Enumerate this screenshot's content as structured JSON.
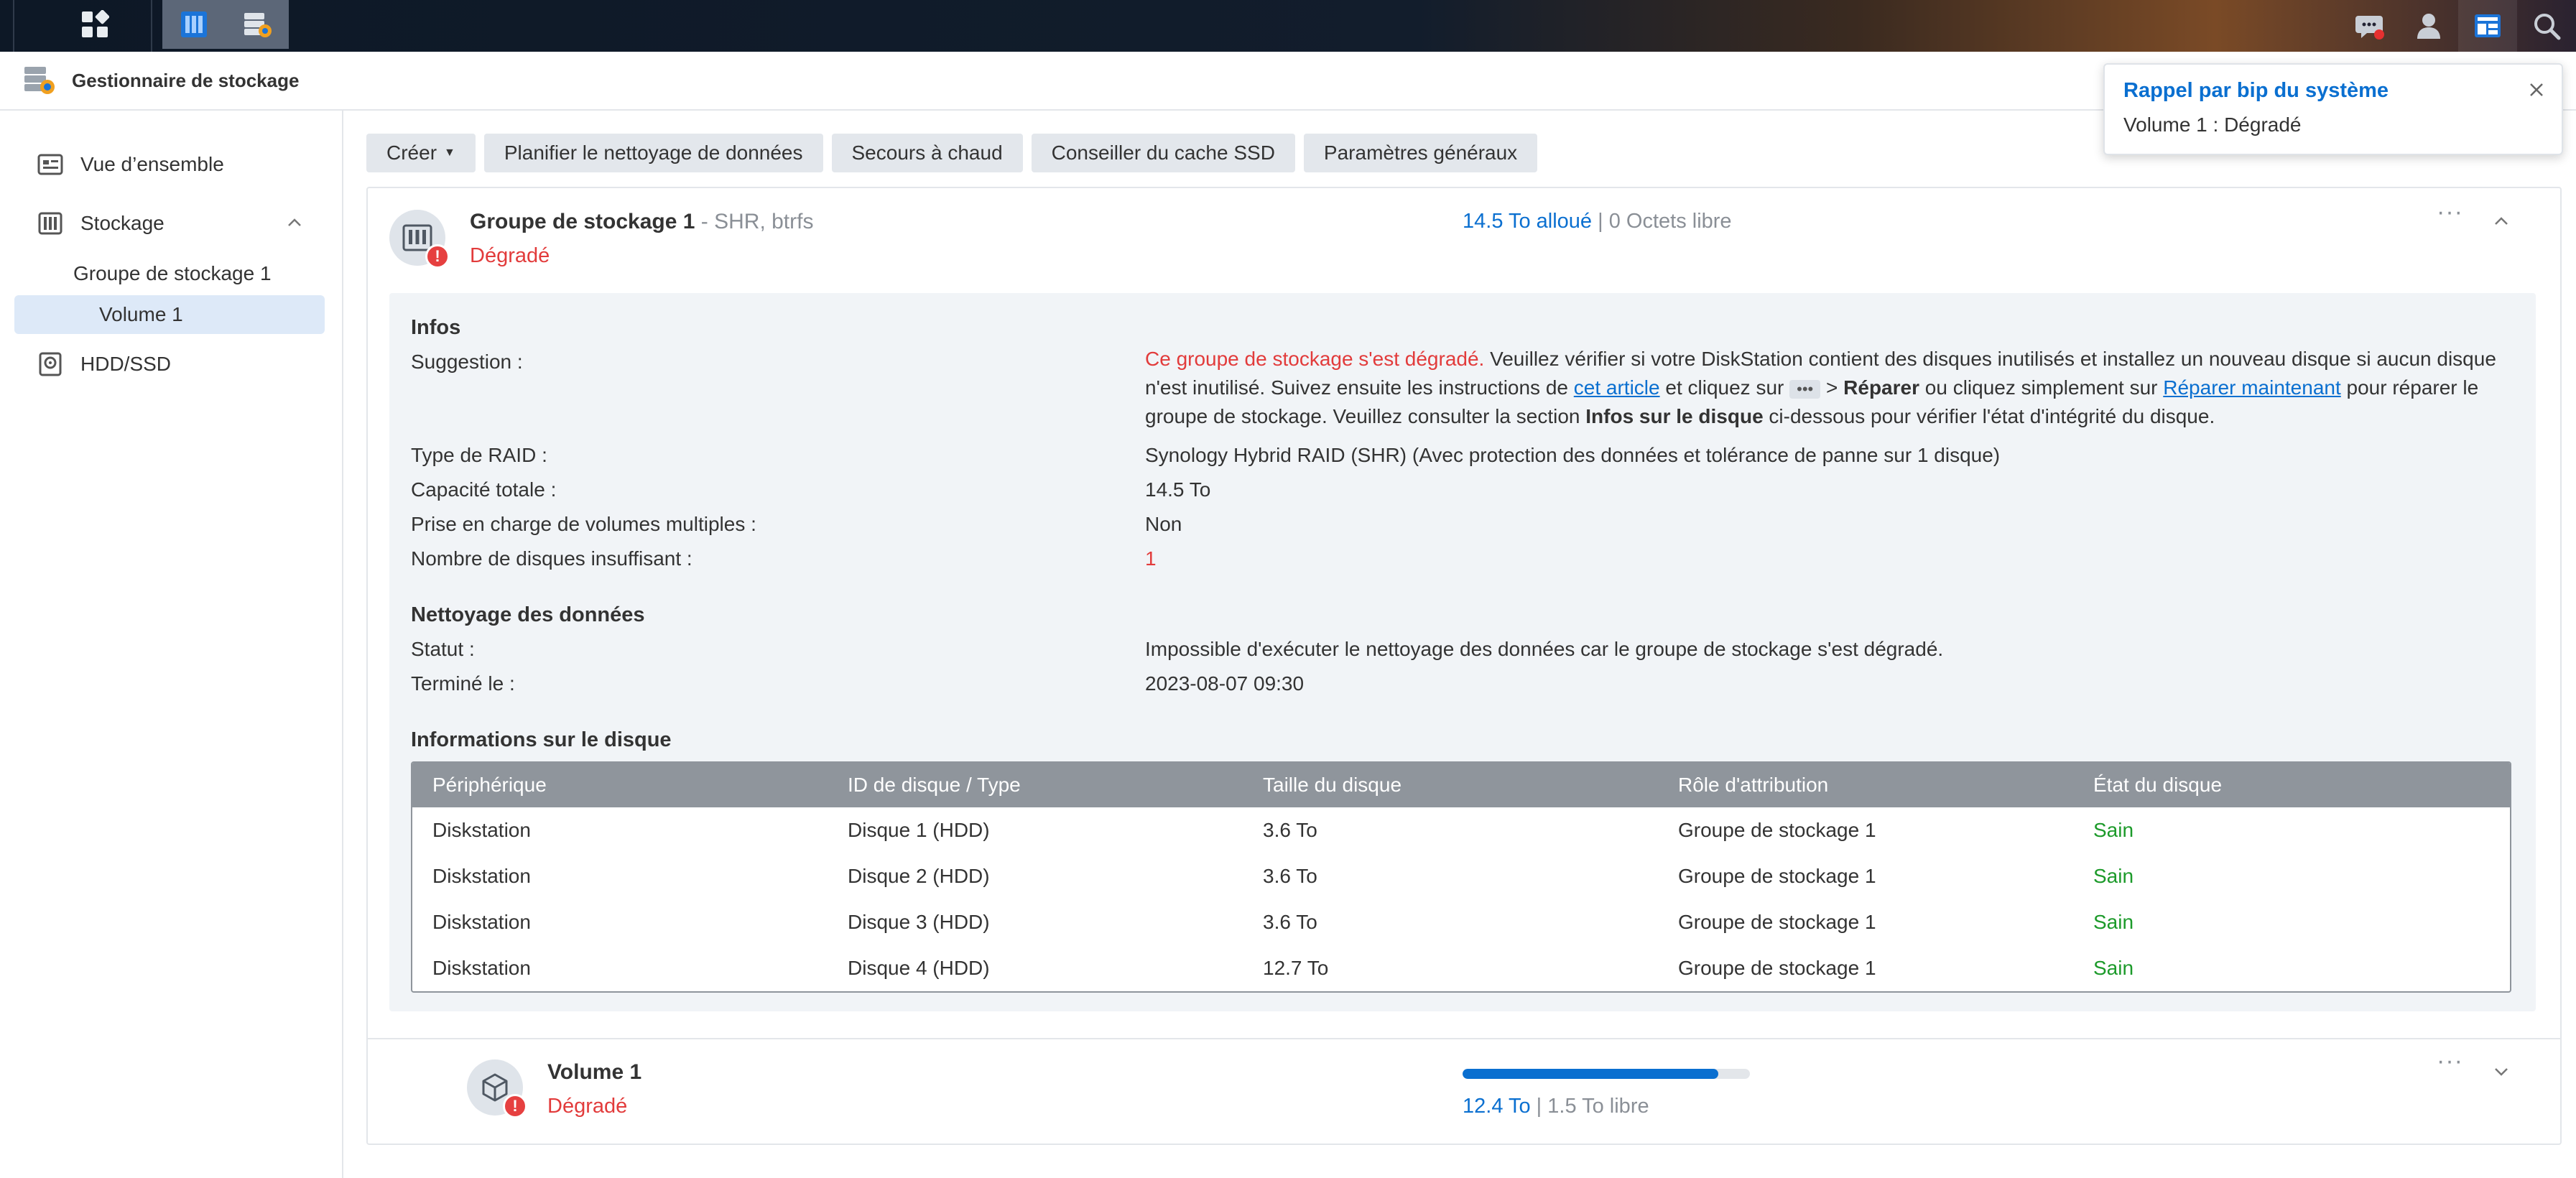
{
  "app": {
    "title": "Gestionnaire de stockage"
  },
  "sidebar": {
    "overview": "Vue d’ensemble",
    "storage": "Stockage",
    "pool": "Groupe de stockage 1",
    "volume": "Volume 1",
    "hdd": "HDD/SSD"
  },
  "toolbar": {
    "create": "Créer",
    "schedule": "Planifier le nettoyage de données",
    "hotspare": "Secours à chaud",
    "ssd": "Conseiller du cache SSD",
    "settings": "Paramètres généraux"
  },
  "pool": {
    "name": "Groupe de stockage 1",
    "meta": " - SHR, btrfs",
    "status": "Dégradé",
    "allocated": "14.5 To alloué",
    "separator": " | ",
    "free": "0 Octets libre"
  },
  "infos": {
    "title": "Infos",
    "suggestion_label": "Suggestion :",
    "suggestion_red": "Ce groupe de stockage s'est dégradé.",
    "suggestion_p1": " Veuillez vérifier si votre DiskStation contient des disques inutilisés et installez un nouveau disque si aucun disque n'est inutilisé. Suivez ensuite les instructions de ",
    "suggestion_link1": "cet article",
    "suggestion_p2": " et cliquez sur ",
    "suggestion_chip": "•••",
    "suggestion_p3": " > ",
    "suggestion_bold1": "Réparer",
    "suggestion_p4": " ou cliquez simplement sur ",
    "suggestion_link2": "Réparer maintenant",
    "suggestion_p5": " pour réparer le groupe de stockage. Veuillez consulter la section ",
    "suggestion_bold2": "Infos sur le disque",
    "suggestion_p6": " ci-dessous pour vérifier l'état d'intégrité du disque.",
    "raid_label": "Type de RAID :",
    "raid_value": "Synology Hybrid RAID (SHR) (Avec protection des données et tolérance de panne sur 1 disque)",
    "capacity_label": "Capacité totale :",
    "capacity_value": "14.5 To",
    "multi_label": "Prise en charge de volumes multiples :",
    "multi_value": "Non",
    "missing_label": "Nombre de disques insuffisant :",
    "missing_value": "1"
  },
  "scrub": {
    "title": "Nettoyage des données",
    "status_label": "Statut :",
    "status_value": "Impossible d'exécuter le nettoyage des données car le groupe de stockage s'est dégradé.",
    "done_label": "Terminé le :",
    "done_value": "2023-08-07 09:30"
  },
  "disks": {
    "title": "Informations sur le disque",
    "headers": [
      "Périphérique",
      "ID de disque / Type",
      "Taille du disque",
      "Rôle d'attribution",
      "État du disque"
    ],
    "rows": [
      [
        "Diskstation",
        "Disque 1 (HDD)",
        "3.6 To",
        "Groupe de stockage 1",
        "Sain"
      ],
      [
        "Diskstation",
        "Disque 2 (HDD)",
        "3.6 To",
        "Groupe de stockage 1",
        "Sain"
      ],
      [
        "Diskstation",
        "Disque 3 (HDD)",
        "3.6 To",
        "Groupe de stockage 1",
        "Sain"
      ],
      [
        "Diskstation",
        "Disque 4 (HDD)",
        "12.7 To",
        "Groupe de stockage 1",
        "Sain"
      ]
    ]
  },
  "volume": {
    "name": "Volume 1",
    "status": "Dégradé",
    "used": "12.4 To",
    "separator": " | ",
    "free": "1.5 To libre",
    "usage_fraction": 0.89
  },
  "notification": {
    "title": "Rappel par bip du système",
    "message": "Volume 1 : Dégradé"
  },
  "colors": {
    "accent": "#0a6fd0",
    "error": "#e23b3b",
    "healthy": "#1c9a2a"
  },
  "icons": [
    "apps-grid-icon",
    "storage-manager-icon",
    "storage-app-icon",
    "chat-icon",
    "user-icon",
    "widgets-icon",
    "search-icon",
    "overview-icon",
    "storage-icon",
    "disk-icon",
    "close-icon",
    "more-icon",
    "chevron-up-icon",
    "chevron-down-icon",
    "cube-icon"
  ]
}
